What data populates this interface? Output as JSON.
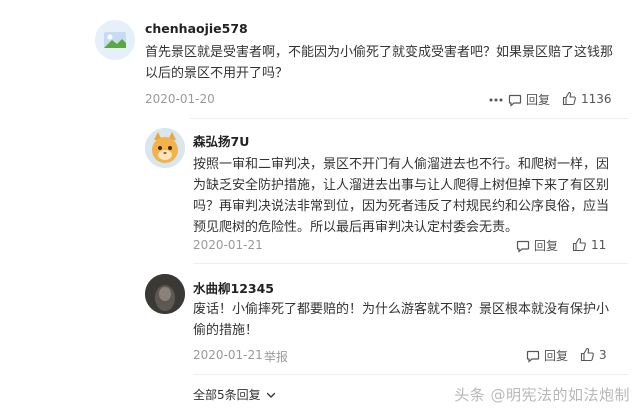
{
  "comments": [
    {
      "username": "chenhaojie578",
      "text": "首先景区就是受害者啊，不能因为小偷死了就变成受害者吧？如果景区赔了这钱那以后的景区不用开了吗？",
      "date": "2020-01-20",
      "report_label": "",
      "reply_label": "回复",
      "likes": "1136"
    },
    {
      "username": "森弘扬7U",
      "text": "按照一审和二审判决，景区不开门有人偷溜进去也不行。和爬树一样，因为缺乏安全防护措施，让人溜进去出事与让人爬得上树但掉下来了有区别吗？再审判决说法非常到位，因为死者违反了村规民约和公序良俗，应当预见爬树的危险性。所以最后再审判决认定村委会无责。",
      "date": "2020-01-21",
      "report_label": "",
      "reply_label": "回复",
      "likes": "11"
    },
    {
      "username": "水曲柳12345",
      "text": "废话！小偷摔死了都要赔的！为什么游客就不赔？景区根本就没有保护小偷的措施！",
      "date": "2020-01-21",
      "report_label": "举报",
      "reply_label": "回复",
      "likes": "3"
    }
  ],
  "footer": {
    "show_all_label": "全部5条回复"
  },
  "watermark": "头条 @明宪法的如法炮制"
}
